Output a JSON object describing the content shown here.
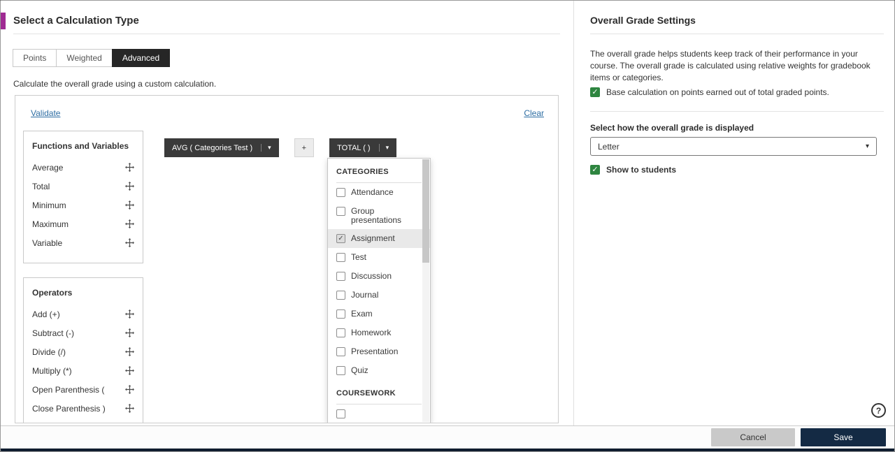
{
  "left": {
    "title": "Select a Calculation Type",
    "tabs": [
      {
        "label": "Points",
        "selected": false
      },
      {
        "label": "Weighted",
        "selected": false
      },
      {
        "label": "Advanced",
        "selected": true
      }
    ],
    "description": "Calculate the overall grade using a custom calculation.",
    "builder": {
      "validate_label": "Validate",
      "clear_label": "Clear",
      "functions_panel": {
        "title": "Functions and Variables",
        "items": [
          {
            "label": "Average"
          },
          {
            "label": "Total"
          },
          {
            "label": "Minimum"
          },
          {
            "label": "Maximum"
          },
          {
            "label": "Variable"
          }
        ]
      },
      "operators_panel": {
        "title": "Operators",
        "items": [
          {
            "label": "Add (+)"
          },
          {
            "label": "Subtract (-)"
          },
          {
            "label": "Divide (/)"
          },
          {
            "label": "Multiply (*)"
          },
          {
            "label": "Open Parenthesis ("
          },
          {
            "label": "Close Parenthesis )"
          }
        ]
      },
      "chips": [
        {
          "label": "AVG ( Categories Test )",
          "dark": true,
          "caret": true
        },
        {
          "label": "+",
          "dark": false,
          "caret": false
        },
        {
          "label": "TOTAL ( )",
          "dark": true,
          "caret": true
        }
      ],
      "dropdown": {
        "sections": [
          {
            "header": "CATEGORIES",
            "items": [
              {
                "label": "Attendance",
                "checked": false
              },
              {
                "label": "Group presentations",
                "checked": false
              },
              {
                "label": "Assignment",
                "checked": true
              },
              {
                "label": "Test",
                "checked": false
              },
              {
                "label": "Discussion",
                "checked": false
              },
              {
                "label": "Journal",
                "checked": false
              },
              {
                "label": "Exam",
                "checked": false
              },
              {
                "label": "Homework",
                "checked": false
              },
              {
                "label": "Presentation",
                "checked": false
              },
              {
                "label": "Quiz",
                "checked": false
              }
            ]
          },
          {
            "header": "COURSEWORK",
            "items": [
              {
                "label": "",
                "checked": false
              }
            ]
          }
        ]
      }
    }
  },
  "right": {
    "title": "Overall Grade Settings",
    "description": "The overall grade helps students keep track of their performance in your course. The overall grade is calculated using relative weights for gradebook items or categories.",
    "base_points_checkbox": {
      "label": "Base calculation on points earned out of total graded points.",
      "checked": true
    },
    "display_label": "Select how the overall grade is displayed",
    "display_value": "Letter",
    "show_to_students_checkbox": {
      "label": "Show to students",
      "checked": true
    }
  },
  "footer": {
    "cancel_label": "Cancel",
    "save_label": "Save"
  },
  "help": {
    "label": "?"
  },
  "colors": {
    "accent": "#a02b93",
    "link": "#2d6da3",
    "tab_selected": "#262626",
    "chip_dark": "#3a3a3a",
    "green": "#2e8540",
    "cancel_bg": "#c9c9c9",
    "save_bg": "#142a44",
    "bottom_bar": "#0e1c2e"
  }
}
